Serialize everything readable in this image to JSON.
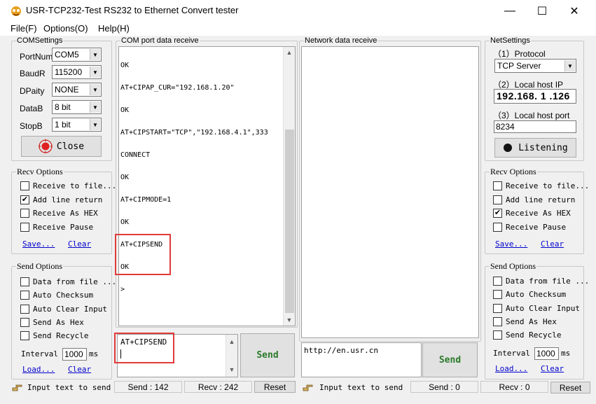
{
  "window": {
    "title": "USR-TCP232-Test  RS232 to Ethernet Convert tester",
    "minimize": "—",
    "maximize": "☐",
    "close": "✕"
  },
  "menu": [
    "File(F)",
    "Options(O)",
    "Help(H)"
  ],
  "com_settings": {
    "title": "COMSettings",
    "port_label": "PortNum",
    "port_value": "COM5",
    "baud_label": "BaudR",
    "baud_value": "115200",
    "parity_label": "DPaity",
    "parity_value": "NONE",
    "data_label": "DataB",
    "data_value": "8 bit",
    "stop_label": "StopB",
    "stop_value": "1 bit",
    "close_button": "Close"
  },
  "left_recv_options": {
    "title": "Recv Options",
    "items": [
      {
        "label": "Receive to file...",
        "checked": false
      },
      {
        "label": "Add line return",
        "checked": true
      },
      {
        "label": "Receive As HEX",
        "checked": false
      },
      {
        "label": "Receive Pause",
        "checked": false
      }
    ],
    "save": "Save...",
    "clear": "Clear"
  },
  "left_send_options": {
    "title": "Send Options",
    "items": [
      {
        "label": "Data from file ...",
        "checked": false
      },
      {
        "label": "Auto Checksum",
        "checked": false
      },
      {
        "label": "Auto Clear Input",
        "checked": false
      },
      {
        "label": "Send As Hex",
        "checked": false
      },
      {
        "label": "Send Recycle",
        "checked": false
      }
    ],
    "interval_label": "Interval",
    "interval_value": "1000",
    "interval_unit": "ms",
    "load": "Load...",
    "clear": "Clear"
  },
  "com_receive": {
    "title": "COM port data receive",
    "lines": [
      "OK",
      "AT+CIPAP_CUR=\"192.168.1.20\"",
      "OK",
      "AT+CIPSTART=\"TCP\",\"192.168.4.1\",333",
      "CONNECT",
      "OK",
      "AT+CIPMODE=1",
      "OK",
      "AT+CIPSEND",
      "OK",
      ">"
    ]
  },
  "com_send": {
    "input_value": "AT+CIPSEND",
    "send_button": "Send"
  },
  "network_receive": {
    "title": "Network data receive"
  },
  "network_send": {
    "input_value": "http://en.usr.cn",
    "send_button": "Send"
  },
  "net_settings": {
    "title": "NetSettings",
    "protocol_label": "（1）Protocol",
    "protocol_value": "TCP Server",
    "local_ip_label": "（2）Local host IP",
    "local_ip_value": "192.168. 1 .126",
    "local_port_label": "（3）Local host port",
    "local_port_value": "8234",
    "listen_button": "Listening"
  },
  "right_recv_options": {
    "title": "Recv Options",
    "items": [
      {
        "label": "Receive to file...",
        "checked": false
      },
      {
        "label": "Add line return",
        "checked": false
      },
      {
        "label": "Receive As HEX",
        "checked": true
      },
      {
        "label": "Receive Pause",
        "checked": false
      }
    ],
    "save": "Save...",
    "clear": "Clear"
  },
  "right_send_options": {
    "title": "Send Options",
    "items": [
      {
        "label": "Data from file ...",
        "checked": false
      },
      {
        "label": "Auto Checksum",
        "checked": false
      },
      {
        "label": "Auto Clear Input",
        "checked": false
      },
      {
        "label": "Send As Hex",
        "checked": false
      },
      {
        "label": "Send Recycle",
        "checked": false
      }
    ],
    "interval_label": "Interval",
    "interval_value": "1000",
    "interval_unit": "ms",
    "load": "Load...",
    "clear": "Clear"
  },
  "status_left": {
    "hint": "Input text to send",
    "send": "Send : 142",
    "recv": "Recv : 242",
    "reset": "Reset"
  },
  "status_right": {
    "hint": "Input text to send",
    "send": "Send : 0",
    "recv": "Recv : 0",
    "reset": "Reset"
  },
  "colors": {
    "highlight": "#e03a3a",
    "send_text": "#2a7a2a",
    "link": "#0000cc"
  }
}
